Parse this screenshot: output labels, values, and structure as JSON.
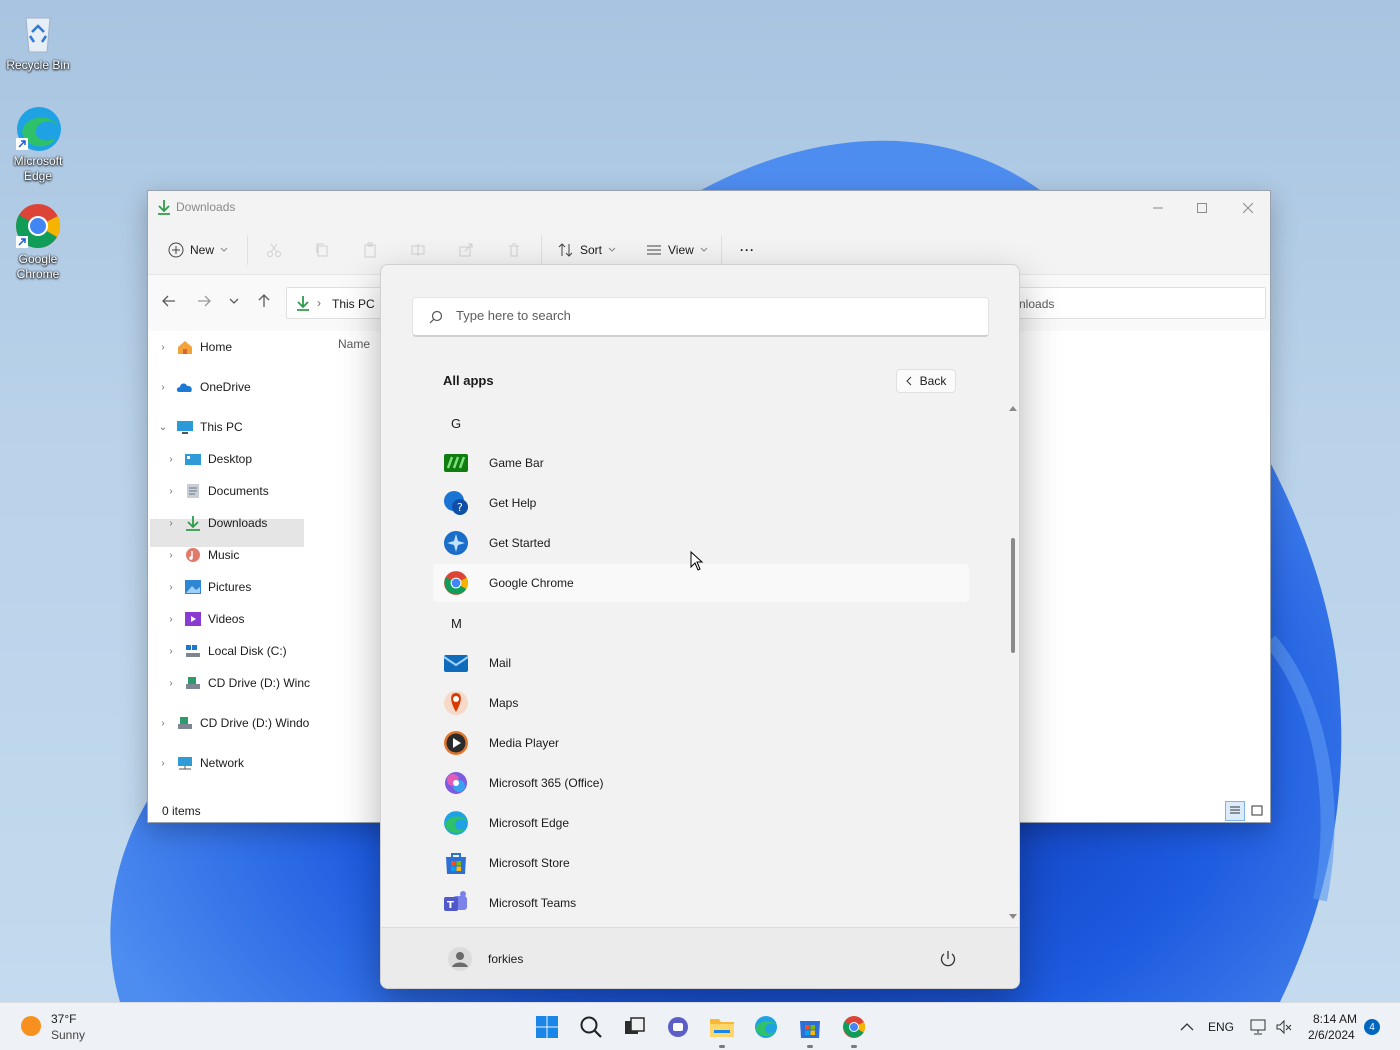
{
  "desktop": {
    "icons": [
      {
        "label": "Recycle Bin"
      },
      {
        "label": "Microsoft Edge"
      },
      {
        "label": "Google Chrome"
      }
    ]
  },
  "explorer": {
    "title": "Downloads",
    "toolbar": {
      "new_label": "New",
      "sort_label": "Sort",
      "view_label": "View",
      "more_label": "···"
    },
    "address": {
      "crumb_1": "This PC",
      "crumb_tail": "nloads"
    },
    "column_header": "Name",
    "tree": [
      {
        "label": "Home"
      },
      {
        "label": "OneDrive"
      },
      {
        "label": "This PC"
      },
      {
        "label": "Desktop"
      },
      {
        "label": "Documents"
      },
      {
        "label": "Downloads"
      },
      {
        "label": "Music"
      },
      {
        "label": "Pictures"
      },
      {
        "label": "Videos"
      },
      {
        "label": "Local Disk (C:)"
      },
      {
        "label": "CD Drive (D:) Winc"
      },
      {
        "label": "CD Drive (D:) Windo"
      },
      {
        "label": "Network"
      }
    ],
    "status": "0 items"
  },
  "start_menu": {
    "search_placeholder": "Type here to search",
    "all_apps_title": "All apps",
    "back_label": "Back",
    "sections": {
      "g": "G",
      "m": "M"
    },
    "apps": [
      {
        "name": "Game Bar",
        "icon": "game-bar-icon"
      },
      {
        "name": "Get Help",
        "icon": "get-help-icon"
      },
      {
        "name": "Get Started",
        "icon": "get-started-icon"
      },
      {
        "name": "Google Chrome",
        "icon": "chrome-icon"
      },
      {
        "name": "Mail",
        "icon": "mail-icon"
      },
      {
        "name": "Maps",
        "icon": "maps-icon"
      },
      {
        "name": "Media Player",
        "icon": "media-player-icon"
      },
      {
        "name": "Microsoft 365 (Office)",
        "icon": "office-icon"
      },
      {
        "name": "Microsoft Edge",
        "icon": "edge-icon"
      },
      {
        "name": "Microsoft Store",
        "icon": "store-icon"
      },
      {
        "name": "Microsoft Teams",
        "icon": "teams-icon"
      }
    ],
    "user_name": "forkies"
  },
  "taskbar": {
    "weather_temp": "37°F",
    "weather_desc": "Sunny",
    "language": "ENG",
    "time": "8:14 AM",
    "date": "2/6/2024",
    "notification_count": "4"
  },
  "colors": {
    "accent": "#0067c0",
    "wallpaper_blue": "#1a4fd6"
  }
}
